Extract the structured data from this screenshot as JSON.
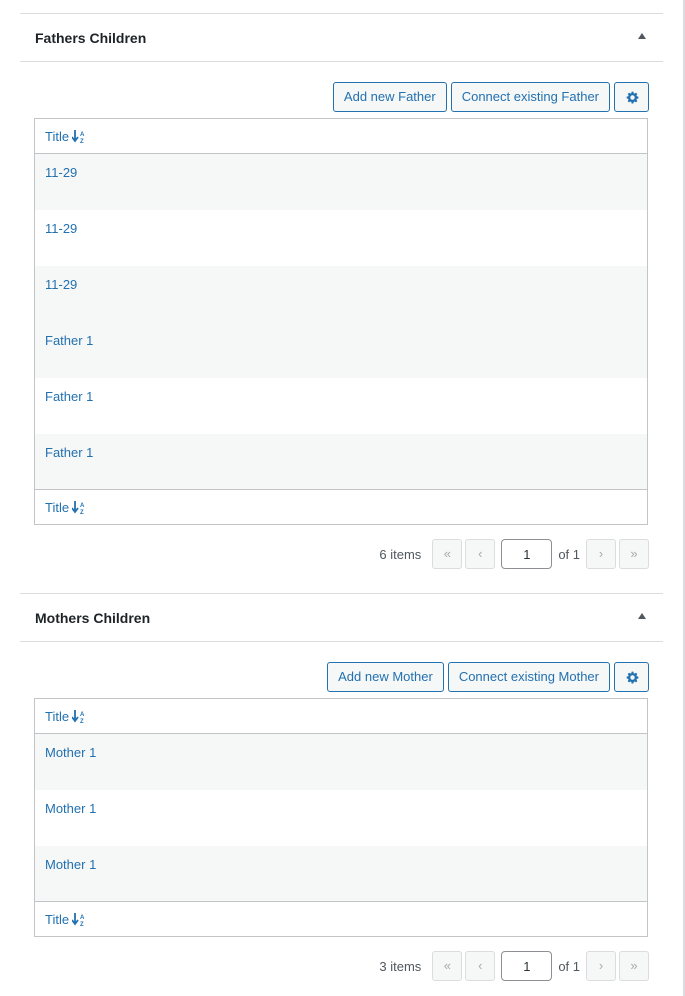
{
  "fathers": {
    "title": "Fathers Children",
    "add_label": "Add new Father",
    "connect_label": "Connect existing Father",
    "column_header": "Title",
    "rows": [
      "11-29",
      "11-29",
      "11-29",
      "Father 1",
      "Father 1",
      "Father 1"
    ],
    "items_count": "6 items",
    "page_value": "1",
    "of_pages": "of 1"
  },
  "mothers": {
    "title": "Mothers Children",
    "add_label": "Add new Mother",
    "connect_label": "Connect existing Mother",
    "column_header": "Title",
    "rows": [
      "Mother 1",
      "Mother 1",
      "Mother 1"
    ],
    "items_count": "3 items",
    "page_value": "1",
    "of_pages": "of 1"
  },
  "pagination_glyphs": {
    "first": "«",
    "prev": "‹",
    "next": "›",
    "last": "»"
  },
  "icons": {
    "gear": "gear-icon",
    "sort": "sort-alpha-icon",
    "toggle": "arrow-up-icon"
  },
  "colors": {
    "link": "#2271b1",
    "border": "#c3c4c7",
    "alt_row": "#f6f7f7"
  }
}
